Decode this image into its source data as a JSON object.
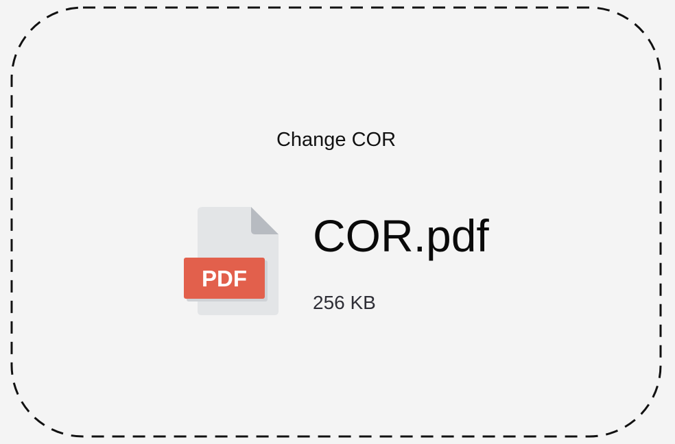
{
  "dropzone": {
    "change_label": "Change COR"
  },
  "file": {
    "name": "COR.pdf",
    "size": "256 KB",
    "type_badge": "PDF",
    "icon": "pdf-file-icon"
  },
  "colors": {
    "background": "#f4f4f4",
    "border": "#111111",
    "badge": "#e2604c",
    "page": "#e3e5e7",
    "fold": "#b7bbc1"
  }
}
